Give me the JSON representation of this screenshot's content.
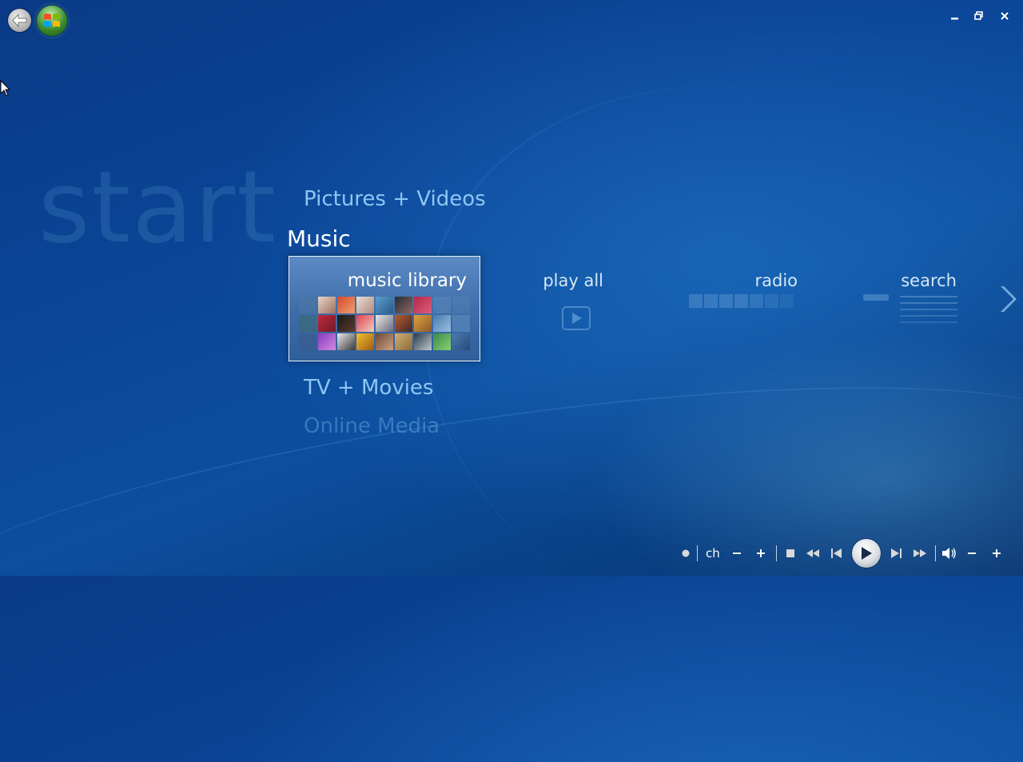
{
  "heading": "start",
  "menu": {
    "pictures_videos": "Pictures + Videos",
    "music": "Music",
    "tv_movies": "TV + Movies",
    "online_media": "Online Media"
  },
  "music_tiles": {
    "library": "music library",
    "play_all": "play all",
    "radio": "radio",
    "search": "search"
  },
  "transport": {
    "channel_label": "ch"
  },
  "icons": {
    "back": "back-arrow-icon",
    "start": "windows-logo-icon",
    "minimize": "minimize-icon",
    "restore": "restore-icon",
    "close": "close-icon",
    "record": "record-icon",
    "stop": "stop-icon",
    "rewind": "rewind-icon",
    "previous": "skip-previous-icon",
    "play": "play-icon",
    "next": "skip-next-icon",
    "fast_forward": "fast-forward-icon",
    "mute": "speaker-icon",
    "volume_down": "minus-icon",
    "volume_up": "plus-icon"
  },
  "colors": {
    "background": "#0b4597",
    "menu_text": "#8ec6f2",
    "focused_text": "#ffffff",
    "selected_tile": "#4a78b4"
  }
}
